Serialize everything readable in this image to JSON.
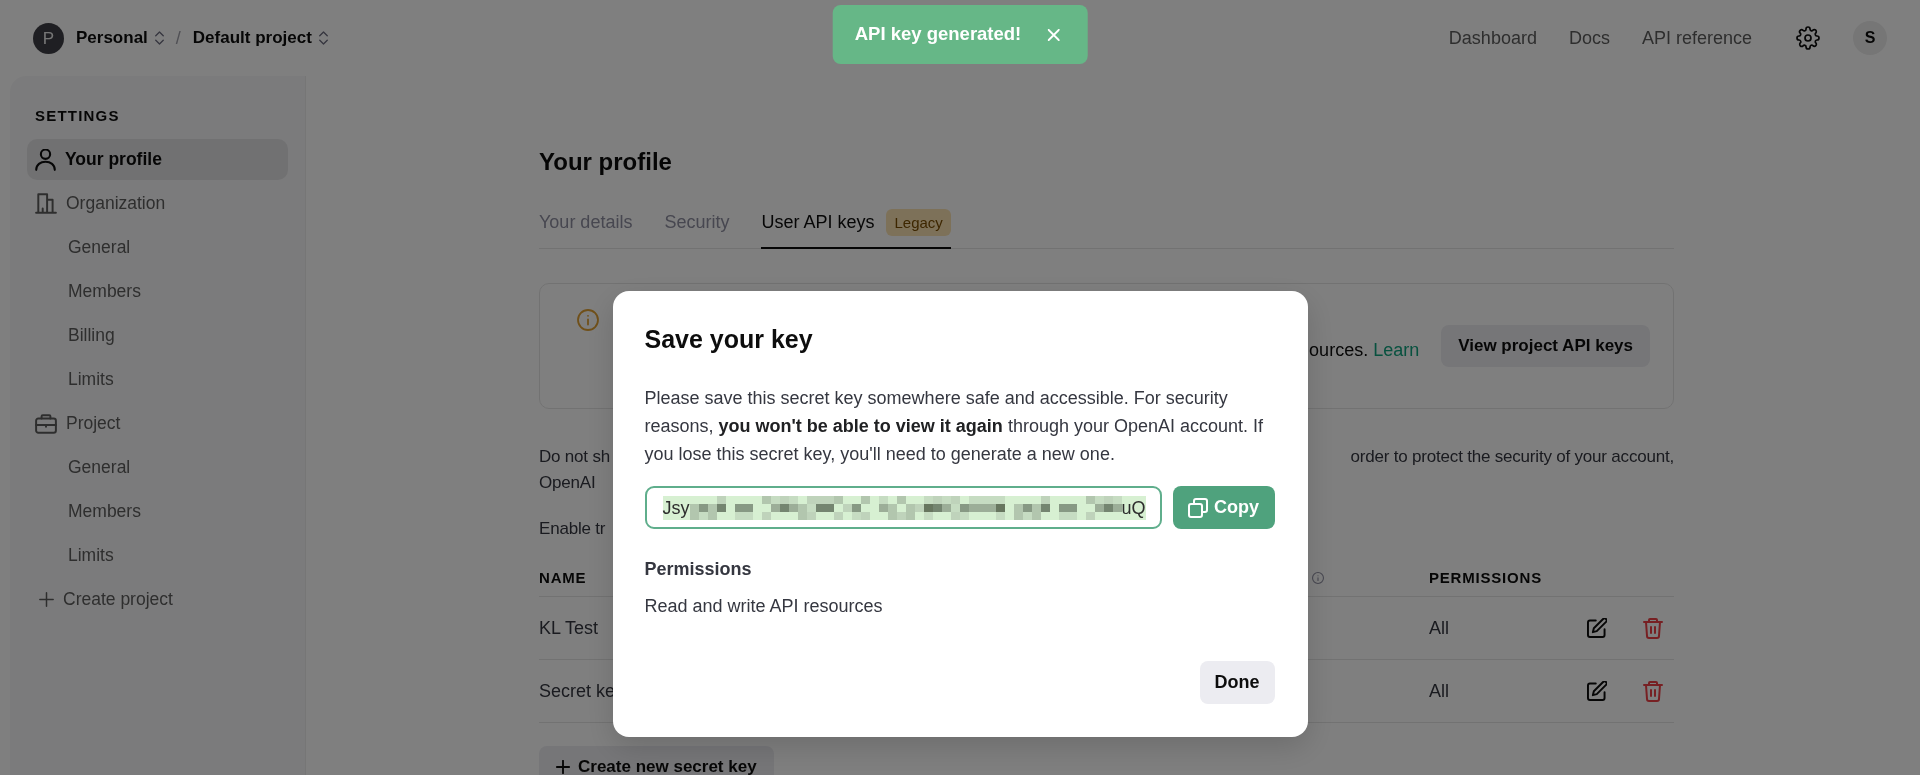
{
  "topbar": {
    "org_initial": "P",
    "org": "Personal",
    "separator": "/",
    "project": "Default project",
    "links": [
      "Dashboard",
      "Docs",
      "API reference"
    ],
    "user_initial": "S"
  },
  "toast": {
    "message": "API key generated!"
  },
  "sidebar": {
    "heading": "SETTINGS",
    "items": [
      {
        "label": "Your profile",
        "kind": "person",
        "selected": true
      },
      {
        "label": "Organization",
        "kind": "building",
        "selected": false,
        "children": [
          {
            "label": "General",
            "selected": false
          },
          {
            "label": "Members",
            "selected": false
          },
          {
            "label": "Billing",
            "selected": false
          },
          {
            "label": "Limits",
            "selected": false
          }
        ]
      },
      {
        "label": "Project",
        "kind": "briefcase",
        "selected": false,
        "children": [
          {
            "label": "General",
            "selected": false
          },
          {
            "label": "Members",
            "selected": false
          },
          {
            "label": "Limits",
            "selected": false
          }
        ]
      },
      {
        "label": "Create project",
        "kind": "add",
        "selected": false
      }
    ]
  },
  "page": {
    "title": "Your profile",
    "tabs": [
      {
        "label": "Your details",
        "selected": false
      },
      {
        "label": "Security",
        "selected": false
      },
      {
        "label": "User API keys",
        "selected": true,
        "badge": "Legacy"
      }
    ],
    "notice": {
      "text": "ources.",
      "link": "Learn",
      "button": "View project API keys"
    },
    "text_blocks": [
      {
        "lines": [
          {
            "left": "Do not sh",
            "right": "order to protect the security of your account,"
          },
          {
            "left": "OpenAI"
          }
        ]
      },
      {
        "lines": [
          {
            "left": "Enable tr"
          }
        ]
      }
    ],
    "table": {
      "columns": [
        {
          "kind": "text",
          "label": "NAME"
        },
        {
          "kind": "info"
        },
        {
          "kind": "text",
          "label": "PERMISSIONS"
        }
      ],
      "rows": [
        {
          "name": "KL Test",
          "permissions": "All"
        },
        {
          "name": "Secret ke",
          "permissions": "All"
        }
      ]
    },
    "create_button": "Create new secret key"
  },
  "modal": {
    "title": "Save your key",
    "message": "Please save this secret key somewhere safe and accessible. For security reasons, **you won't be able to view it again** through your OpenAI account. If you lose this secret key, you'll need to generate a new one.",
    "key_field": {
      "value_start": "Jsy",
      "value_end": "uQ"
    },
    "copy_button": "Copy",
    "permissions_heading": "Permissions",
    "permissions": "Read and write API resources",
    "done_button": "Done"
  }
}
